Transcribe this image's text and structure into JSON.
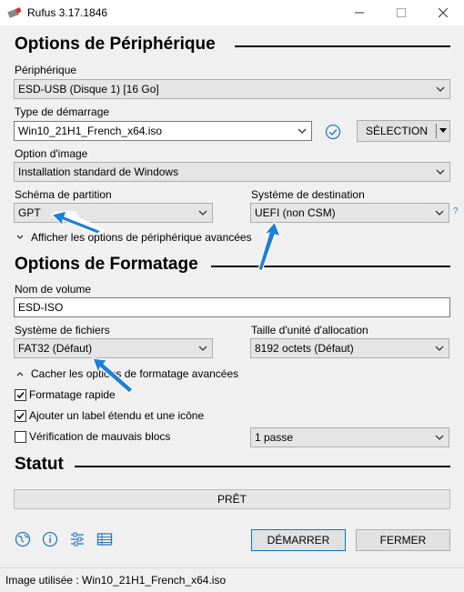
{
  "window": {
    "title": "Rufus 3.17.1846"
  },
  "device_section": {
    "title": "Options de Périphérique",
    "device_label": "Périphérique",
    "device_value": "ESD-USB (Disque 1) [16 Go]",
    "boot_type_label": "Type de démarrage",
    "boot_type_value": "Win10_21H1_French_x64.iso",
    "select_button": "SÉLECTION",
    "image_option_label": "Option d'image",
    "image_option_value": "Installation standard de Windows",
    "partition_label": "Schéma de partition",
    "partition_value": "GPT",
    "target_label": "Système de destination",
    "target_value": "UEFI (non CSM)",
    "help_mark": "?",
    "advanced_toggle": "Afficher les options de périphérique avancées"
  },
  "format_section": {
    "title": "Options de Formatage",
    "volume_label": "Nom de volume",
    "volume_value": "ESD-ISO",
    "fs_label": "Système de fichiers",
    "fs_value": "FAT32 (Défaut)",
    "cluster_label": "Taille d'unité d'allocation",
    "cluster_value": "8192 octets (Défaut)",
    "advanced_toggle": "Cacher les options de formatage avancées",
    "quick_format": "Formatage rapide",
    "quick_format_checked": true,
    "extended_label": "Ajouter un label étendu et une icône",
    "extended_label_checked": true,
    "bad_blocks": "Vérification de mauvais blocs",
    "bad_blocks_checked": false,
    "passes_value": "1 passe"
  },
  "status_section": {
    "title": "Statut",
    "status_text": "PRÊT"
  },
  "actions": {
    "start": "DÉMARRER",
    "close": "FERMER"
  },
  "statusbar": {
    "text": "Image utilisée : Win10_21H1_French_x64.iso"
  },
  "colors": {
    "accent": "#0078d7",
    "annotation_arrow": "#1e7fd8"
  }
}
